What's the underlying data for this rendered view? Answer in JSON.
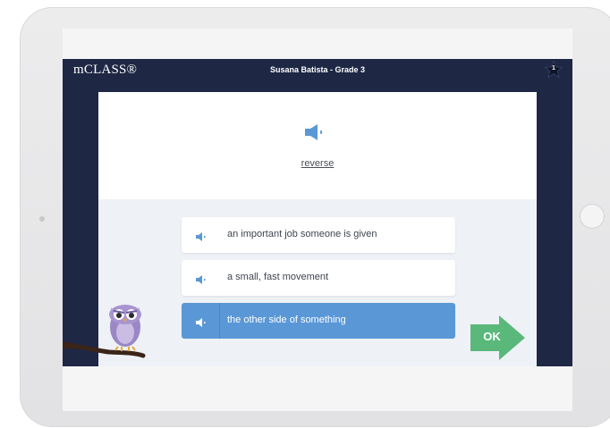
{
  "header": {
    "logo": "mCLASS®",
    "student": "Susana Batista - Grade 3",
    "star_count": "1"
  },
  "prompt": {
    "word": "reverse",
    "audio_icon": "speaker-icon"
  },
  "options": [
    {
      "text": "an important job someone is given",
      "selected": false
    },
    {
      "text": "a small, fast movement",
      "selected": false
    },
    {
      "text": "the other side of something",
      "selected": true
    }
  ],
  "ok_button": {
    "label": "OK"
  },
  "colors": {
    "topbar": "#1e2744",
    "selected": "#5a97d6",
    "speaker": "#5a97d6",
    "ok": "#59b87a"
  }
}
